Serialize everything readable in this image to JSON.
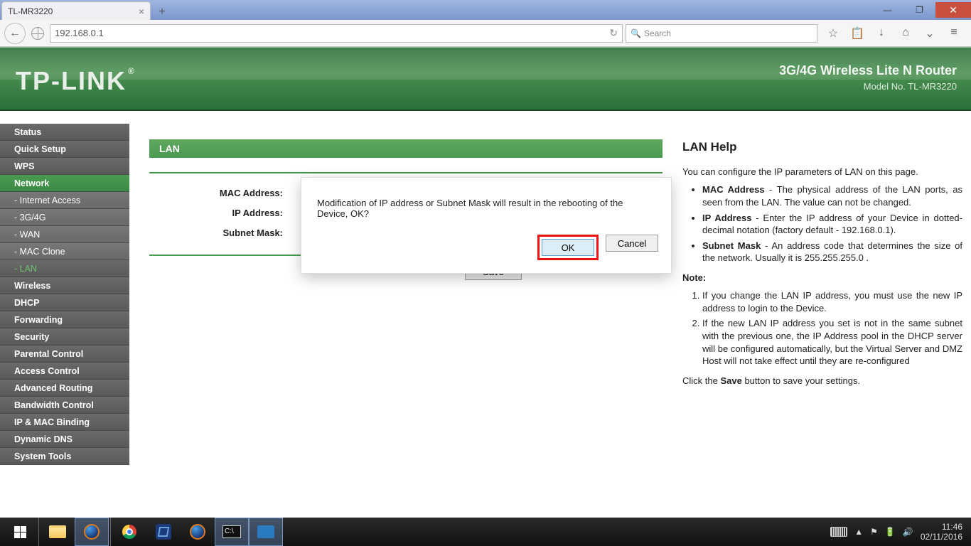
{
  "window": {
    "tab_title": "TL-MR3220",
    "min": "—",
    "max": "❐",
    "close": "✕"
  },
  "browser": {
    "url": "192.168.0.1",
    "search_placeholder": "Search",
    "icons": {
      "back": "←",
      "reload": "↻",
      "search": "🔍",
      "star": "☆",
      "clipboard": "📋",
      "download": "↓",
      "home": "⌂",
      "pocket": "⌄",
      "menu": "≡"
    }
  },
  "header": {
    "brand": "TP-LINK",
    "reg": "®",
    "line1": "3G/4G Wireless Lite N Router",
    "line2": "Model No. TL-MR3220"
  },
  "sidebar": {
    "items": [
      {
        "label": "Status"
      },
      {
        "label": "Quick Setup"
      },
      {
        "label": "WPS"
      },
      {
        "label": "Network",
        "main_active": true
      },
      {
        "label": "- Internet Access",
        "sub": true
      },
      {
        "label": "- 3G/4G",
        "sub": true
      },
      {
        "label": "- WAN",
        "sub": true
      },
      {
        "label": "- MAC Clone",
        "sub": true
      },
      {
        "label": "- LAN",
        "sub": true,
        "sub_active": true
      },
      {
        "label": "Wireless"
      },
      {
        "label": "DHCP"
      },
      {
        "label": "Forwarding"
      },
      {
        "label": "Security"
      },
      {
        "label": "Parental Control"
      },
      {
        "label": "Access Control"
      },
      {
        "label": "Advanced Routing"
      },
      {
        "label": "Bandwidth Control"
      },
      {
        "label": "IP & MAC Binding"
      },
      {
        "label": "Dynamic DNS"
      },
      {
        "label": "System Tools"
      }
    ]
  },
  "panel": {
    "title": "LAN",
    "mac_label": "MAC Address:",
    "ip_label": "IP Address:",
    "mask_label": "Subnet Mask:",
    "save": "Save"
  },
  "dialog": {
    "message": "Modification of IP address or Subnet Mask will result in the rebooting of the Device, OK?",
    "ok": "OK",
    "cancel": "Cancel"
  },
  "help": {
    "title": "LAN Help",
    "intro": "You can configure the IP parameters of LAN on this page.",
    "bullets": {
      "mac_b": "MAC Address",
      "mac_t": " - The physical address of the LAN ports, as seen from the LAN. The value can not be changed.",
      "ip_b": "IP Address",
      "ip_t": " - Enter the IP address of your Device in dotted-decimal notation (factory default - 192.168.0.1).",
      "mask_b": "Subnet Mask",
      "mask_t": " - An address code that determines the size of the network. Usually it is 255.255.255.0 ."
    },
    "note_label": "Note:",
    "notes": {
      "n1": "If you change the LAN IP address, you must use the new IP address to login to the Device.",
      "n2": "If the new LAN IP address you set is not in the same subnet with the previous one, the IP Address pool in the DHCP server will be configured automatically, but the Virtual Server and DMZ Host will not take effect until they are re-configured"
    },
    "save_pre": "Click the ",
    "save_b": "Save",
    "save_post": " button to save your settings."
  },
  "taskbar": {
    "time": "11:46",
    "date": "02/11/2016",
    "tray": {
      "up": "▲",
      "net": "🔊"
    }
  }
}
